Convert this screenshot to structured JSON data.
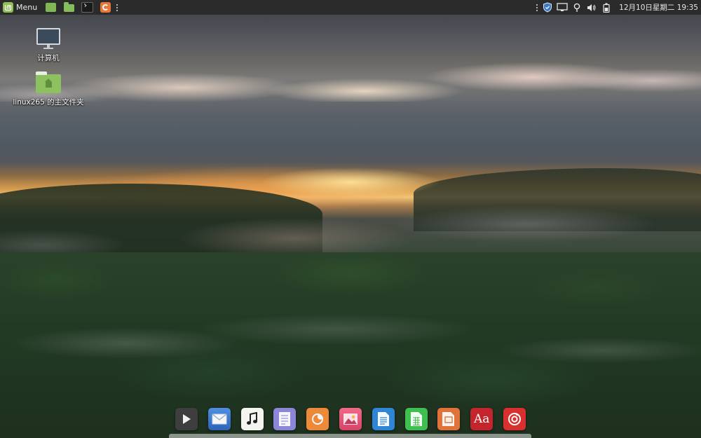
{
  "panel": {
    "menu_label": "Menu",
    "launchers": [
      "files-app-icon",
      "folder-icon",
      "terminal-icon",
      "firefox-icon"
    ],
    "tray": [
      "shield-icon",
      "display-icon",
      "location-icon",
      "volume-icon",
      "battery-icon"
    ],
    "clock": "12月10日星期二 19:35"
  },
  "desktop": {
    "icons": [
      {
        "label": "计算机",
        "icon": "computer-icon"
      },
      {
        "label": "linux265 的主文件夹",
        "icon": "home-folder-icon"
      }
    ]
  },
  "dock": {
    "apps": [
      "media-player-icon",
      "mail-icon",
      "music-icon",
      "notes-icon",
      "firefox-icon",
      "image-viewer-icon",
      "writer-icon",
      "spreadsheet-icon",
      "presentation-icon",
      "dictionary-icon",
      "netease-music-icon"
    ],
    "dictionary_label": "Aa"
  },
  "colors": {
    "panel_bg": "#2b2b2b",
    "mint_green": "#8fbe5a"
  }
}
